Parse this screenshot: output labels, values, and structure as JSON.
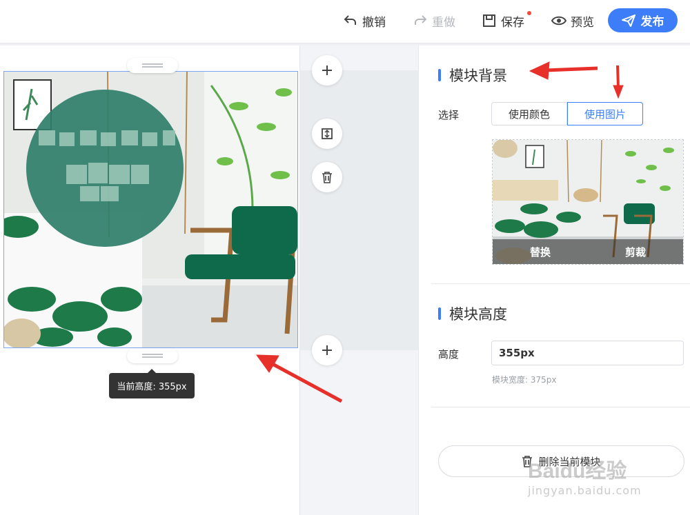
{
  "toolbar": {
    "undo_label": "撤销",
    "redo_label": "重做",
    "save_label": "保存",
    "preview_label": "预览",
    "publish_label": "发布"
  },
  "canvas": {
    "tooltip": "当前高度: 355px"
  },
  "panel": {
    "background_section": {
      "title": "模块背景",
      "choose_label": "选择",
      "options": [
        "使用颜色",
        "使用图片"
      ],
      "selected": "使用图片",
      "image_actions": [
        "替换",
        "剪裁"
      ]
    },
    "height_section": {
      "title": "模块高度",
      "height_label": "高度",
      "height_value": "355px",
      "width_hint": "模块宽度: 375px"
    },
    "delete_button": "删除当前模块"
  },
  "watermark": {
    "brand": "Baidu经验",
    "url": "jingyan.baidu.com"
  },
  "colors": {
    "accent": "#3d7ef8",
    "annotation_arrow": "#e8302a",
    "teal_overlay": "#2f7f6a"
  },
  "icons": [
    "undo-icon",
    "redo-icon",
    "save-icon",
    "eye-icon",
    "send-icon",
    "plus-icon",
    "resize-icon",
    "trash-icon"
  ]
}
